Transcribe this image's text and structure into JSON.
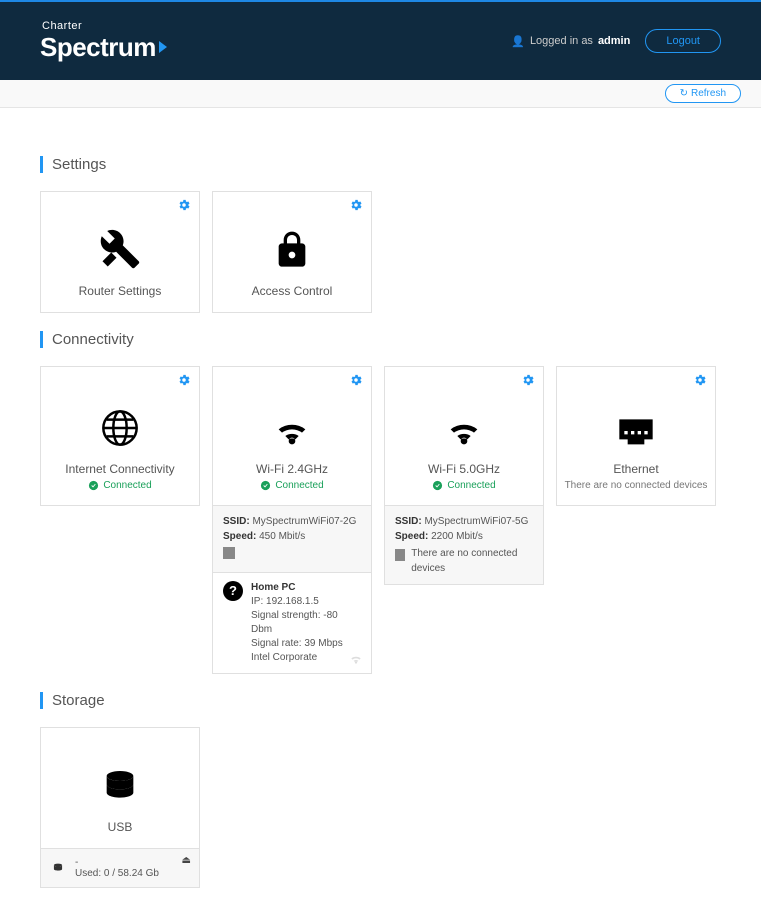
{
  "header": {
    "brand_top": "Charter",
    "brand_bottom": "Spectrum",
    "logged_in_prefix": "Logged in as",
    "username": "admin",
    "logout_label": "Logout"
  },
  "subheader": {
    "refresh_label": "Refresh"
  },
  "sections": {
    "settings_title": "Settings",
    "connectivity_title": "Connectivity",
    "storage_title": "Storage"
  },
  "settings": {
    "router": "Router Settings",
    "access": "Access Control"
  },
  "connectivity": {
    "internet": {
      "title": "Internet Connectivity",
      "status": "Connected"
    },
    "wifi24": {
      "title": "Wi-Fi 2.4GHz",
      "status": "Connected",
      "ssid_label": "SSID:",
      "ssid": "MySpectrumWiFi07-2G",
      "speed_label": "Speed:",
      "speed": "450 Mbit/s",
      "device": {
        "name": "Home PC",
        "ip": "IP: 192.168.1.5",
        "strength": "Signal strength: -80 Dbm",
        "rate": "Signal rate: 39 Mbps",
        "vendor": "Intel Corporate"
      }
    },
    "wifi5": {
      "title": "Wi-Fi 5.0GHz",
      "status": "Connected",
      "ssid_label": "SSID:",
      "ssid": "MySpectrumWiFi07-5G",
      "speed_label": "Speed:",
      "speed": "2200 Mbit/s",
      "no_devices": "There are no connected devices"
    },
    "ethernet": {
      "title": "Ethernet",
      "no_devices": "There are no connected devices"
    }
  },
  "storage": {
    "usb_title": "USB",
    "item": {
      "name": "-",
      "used": "Used: 0 / 58.24 Gb"
    }
  }
}
